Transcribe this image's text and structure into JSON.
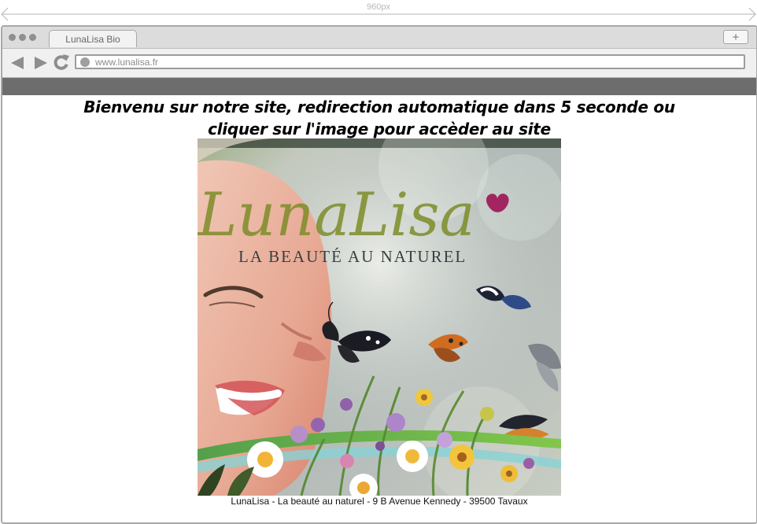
{
  "ruler": {
    "label": "960px"
  },
  "browser": {
    "tab_title": "LunaLisa Bio",
    "new_tab_symbol": "+",
    "url": "www.lunalisa.fr"
  },
  "content": {
    "welcome_line1": "Bienvenu sur notre site, redirection automatique dans 5 seconde ou",
    "welcome_line2": "cliquer sur l'image pour accèder au site",
    "hero_image": {
      "brand_text": "LunaLisa",
      "tagline": "LA BEAUTÉ AU NATUREL"
    },
    "caption": "LunaLisa - La beauté au naturel - 9 B Avenue Kennedy - 39500 Tavaux"
  },
  "icons": {
    "back": "back-arrow-icon",
    "forward": "forward-arrow-icon",
    "reload": "reload-icon",
    "globe": "globe-icon"
  },
  "colors": {
    "frame_border": "#a8a8a8",
    "tabbar": "#dcdcdc",
    "toolbar": "#f0f0f0",
    "gray_band": "#6d6d6d",
    "brand_olive": "#7d8c28"
  }
}
